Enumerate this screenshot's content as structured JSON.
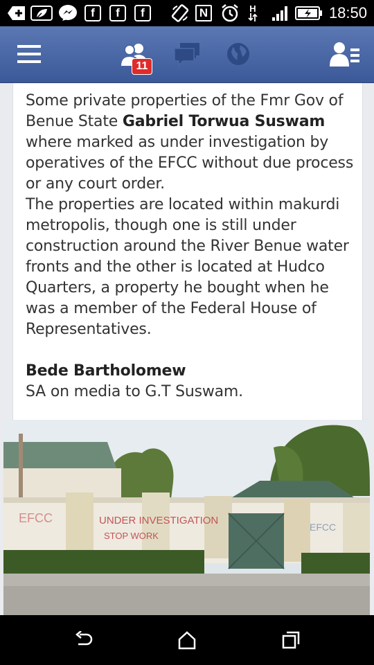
{
  "status_bar": {
    "time": "18:50",
    "notif_labels": [
      "f",
      "f",
      "f"
    ],
    "nfc_label": "N",
    "network_label": "H",
    "icons": [
      "add-icon",
      "leaf-icon",
      "messenger-icon",
      "facebook-icon",
      "facebook-icon",
      "facebook-icon",
      "rotate-icon",
      "nfc-icon",
      "alarm-icon",
      "network-h-icon",
      "signal-icon",
      "battery-charging-icon"
    ]
  },
  "fb_nav": {
    "icons": [
      "menu-icon",
      "friend-requests-icon",
      "messages-icon",
      "globe-icon",
      "people-list-icon"
    ],
    "friend_requests_badge": "11",
    "bar_color": "#3b5998",
    "badge_color": "#e02b2b"
  },
  "post": {
    "intro": "Some private properties of the Fmr Gov of Benue State",
    "name": "Gabriel Torwua Suswam",
    "after_name": "where marked as under investigation by operatives of the EFCC without due process or any court order.",
    "paragraph2": "The properties are located within makurdi metropolis, though one is still under construction around the River Benue water fronts and the other is located at Hudco Quarters, a property he bought when he was a member of the Federal House of Representatives.",
    "author": "Bede Bartholomew",
    "author_title": "SA on media to G.T Suswam."
  },
  "photo": {
    "wall_text_left": "EFCC",
    "wall_text_mid": "UNDER INVESTIGATION",
    "wall_text_sub": "STOP WORK",
    "wall_text_right": "EFCC"
  },
  "nav_bar": {
    "icons": [
      "back-icon",
      "home-icon",
      "recents-icon"
    ]
  }
}
